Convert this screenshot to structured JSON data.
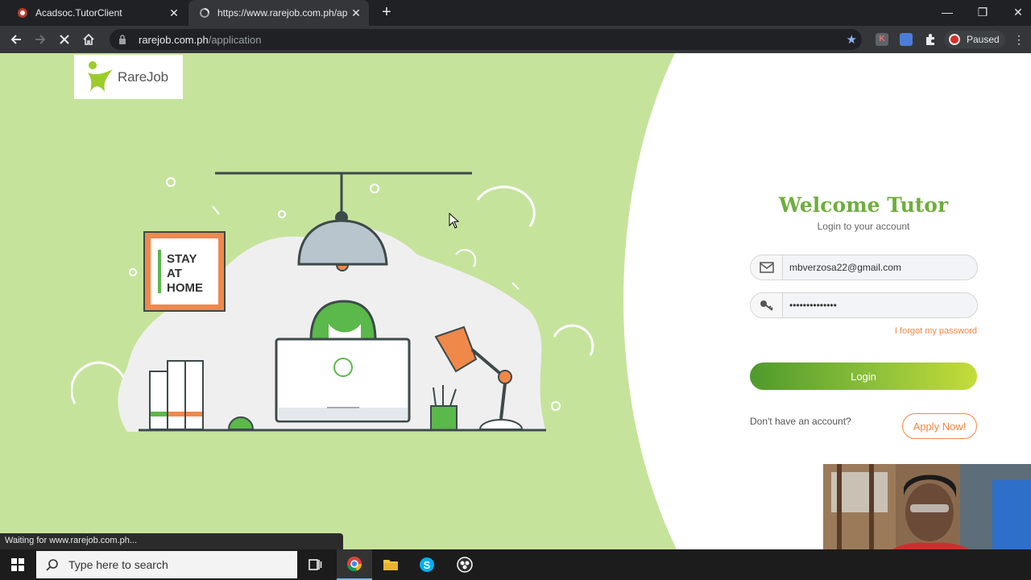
{
  "browser": {
    "tabs": [
      {
        "title": "Acadsoc.TutorClient",
        "favicon": "acadsoc-icon"
      },
      {
        "title": "https://www.rarejob.com.ph/app",
        "favicon": "loading-icon"
      }
    ],
    "url_host": "rarejob.com.ph",
    "url_path": "/application",
    "profile_label": "Paused",
    "status_text": "Waiting for www.rarejob.com.ph..."
  },
  "page": {
    "logo_text": "RareJob",
    "poster_lines": [
      "STAY",
      "AT",
      "HOME"
    ],
    "welcome_title": "Welcome Tutor",
    "welcome_subtitle": "Login to your account",
    "email_value": "mbverzosa22@gmail.com",
    "password_value": "••••••••••••••",
    "forgot_link": "I forgot my password",
    "login_button": "Login",
    "no_account_text": "Don't have an account?",
    "apply_button": "Apply Now!",
    "colors": {
      "green": "#6eae3c",
      "orange": "#f0884a",
      "bg_green": "#c6e39c"
    }
  },
  "taskbar": {
    "search_placeholder": "Type here to search"
  }
}
